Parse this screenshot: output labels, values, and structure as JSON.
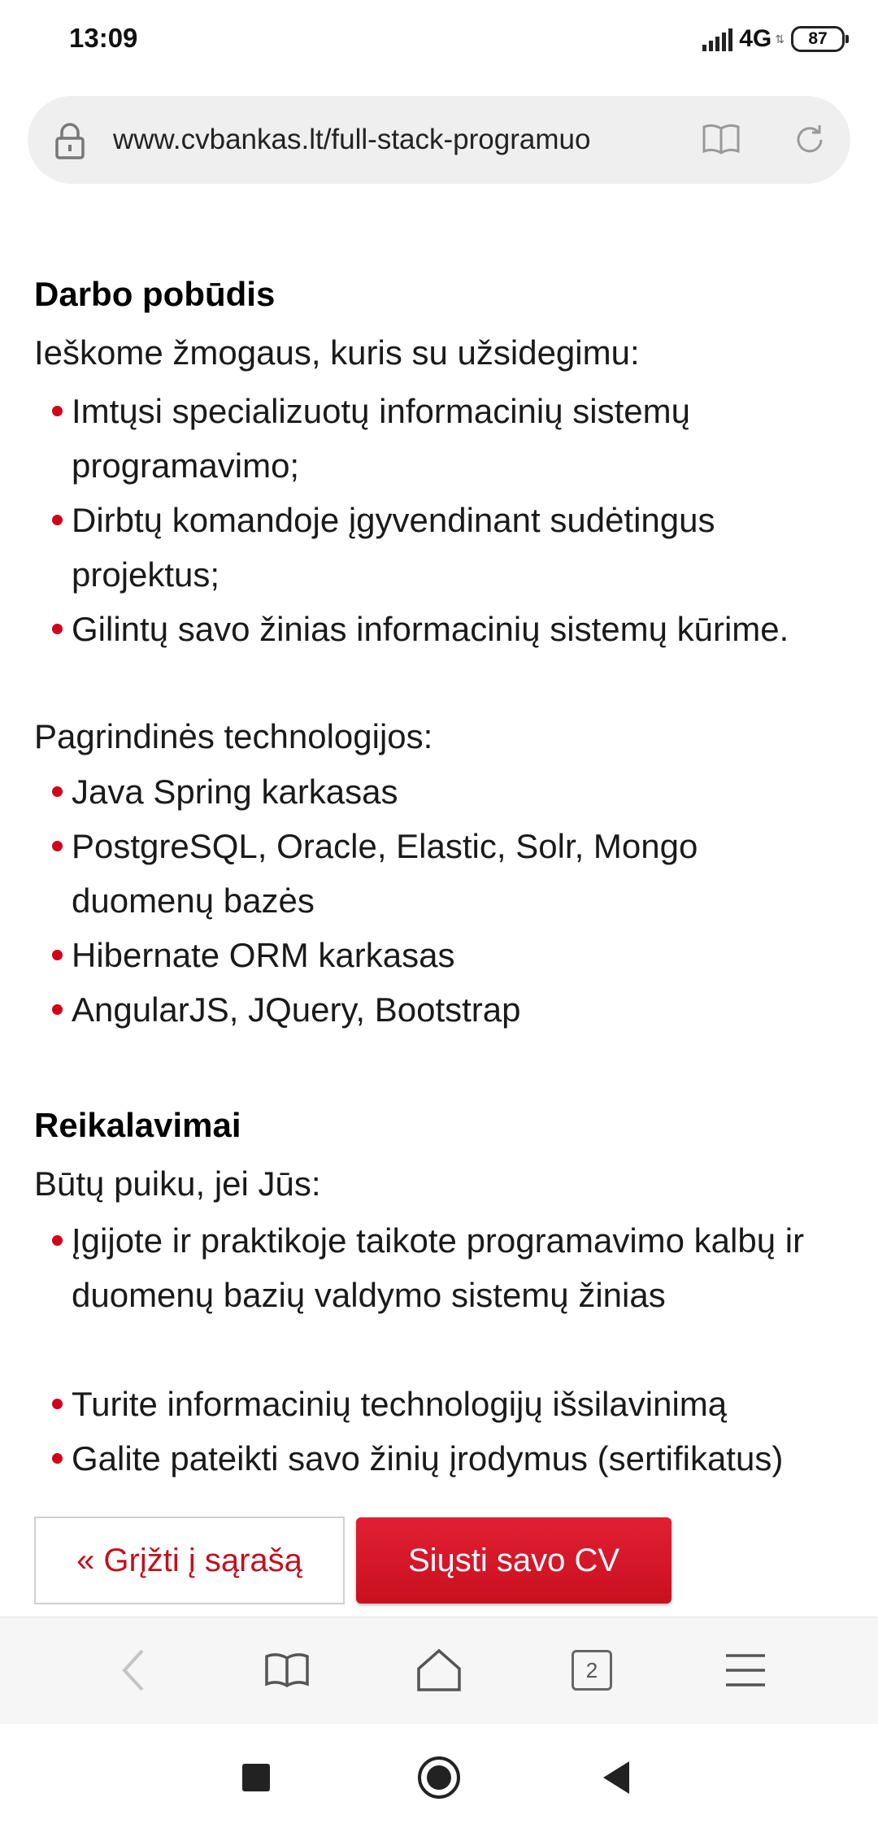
{
  "status_bar": {
    "time": "13:09",
    "network": "4G",
    "battery": "87"
  },
  "address_bar": {
    "url": "www.cvbankas.lt/full-stack-programuo"
  },
  "content": {
    "section1": {
      "title": "Darbo pobūdis",
      "intro": "Ieškome žmogaus, kuris su užsidegimu:",
      "items": [
        "Imtųsi specializuotų informacinių sistemų programavimo;",
        "Dirbtų komandoje įgyvendinant sudėtingus projektus;",
        "Gilintų savo žinias informacinių sistemų kūrime."
      ],
      "tech_intro": "Pagrindinės technologijos:",
      "tech_items": [
        "Java Spring karkasas",
        "PostgreSQL, Oracle, Elastic, Solr, Mongo duomenų bazės",
        "Hibernate ORM karkasas",
        "AngularJS, JQuery, Bootstrap"
      ]
    },
    "section2": {
      "title": "Reikalavimai",
      "intro": "Būtų puiku, jei Jūs:",
      "items": [
        "Įgijote ir praktikoje taikote programavimo kalbų ir duomenų bazių valdymo sistemų žinias",
        "Turite informacinių technologijų išsilavinimą",
        "Galite pateikti savo žinių įrodymus (sertifikatus)"
      ]
    }
  },
  "actions": {
    "back_label": "« Grįžti į sąrašą",
    "send_label": "Siųsti savo CV"
  },
  "toolbar": {
    "tabs_count": "2"
  },
  "colors": {
    "accent": "#d0021b",
    "button": "#d81a2c"
  }
}
